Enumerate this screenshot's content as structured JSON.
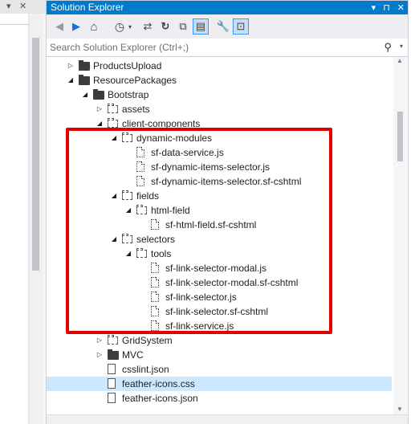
{
  "left_panel": {
    "top_glyphs": [
      "▾",
      "✕"
    ],
    "split_glyph": "✣"
  },
  "panel": {
    "title": "Solution Explorer",
    "title_buttons": {
      "dropdown": "▾",
      "pin": "⊓",
      "close": "✕"
    }
  },
  "toolbar": {
    "back": "◀",
    "forward": "▶",
    "home": "⌂",
    "history": "◷",
    "history_drop": "▾",
    "sync": "⇄",
    "refresh": "↻",
    "collapse": "⧉",
    "show_all": "▤",
    "properties": "🔧",
    "preview": "⊡"
  },
  "search": {
    "placeholder": "Search Solution Explorer (Ctrl+;)",
    "icon": "⚲",
    "dropdown": "▾"
  },
  "tree": [
    {
      "label": "ProductsUpload",
      "icon": "folder-dark",
      "expander": "expand",
      "depth": 0
    },
    {
      "label": "ResourcePackages",
      "icon": "folder-dark",
      "expander": "collapse",
      "depth": 0
    },
    {
      "label": "Bootstrap",
      "icon": "folder-dark",
      "expander": "collapse",
      "depth": 1
    },
    {
      "label": "assets",
      "icon": "folder-dash",
      "expander": "expand",
      "depth": 2
    },
    {
      "label": "client-components",
      "icon": "folder-dash",
      "expander": "collapse",
      "depth": 2
    },
    {
      "label": "dynamic-modules",
      "icon": "folder-dash",
      "expander": "collapse",
      "depth": 3
    },
    {
      "label": "sf-data-service.js",
      "icon": "file",
      "expander": "",
      "depth": 4
    },
    {
      "label": "sf-dynamic-items-selector.js",
      "icon": "file",
      "expander": "",
      "depth": 4
    },
    {
      "label": "sf-dynamic-items-selector.sf-cshtml",
      "icon": "file",
      "expander": "",
      "depth": 4
    },
    {
      "label": "fields",
      "icon": "folder-dash",
      "expander": "collapse",
      "depth": 3
    },
    {
      "label": "html-field",
      "icon": "folder-dash",
      "expander": "collapse",
      "depth": 4
    },
    {
      "label": "sf-html-field.sf-cshtml",
      "icon": "file",
      "expander": "",
      "depth": 5
    },
    {
      "label": "selectors",
      "icon": "folder-dash",
      "expander": "collapse",
      "depth": 3
    },
    {
      "label": "tools",
      "icon": "folder-dash",
      "expander": "collapse",
      "depth": 4
    },
    {
      "label": "sf-link-selector-modal.js",
      "icon": "file",
      "expander": "",
      "depth": 5
    },
    {
      "label": "sf-link-selector-modal.sf-cshtml",
      "icon": "file",
      "expander": "",
      "depth": 5
    },
    {
      "label": "sf-link-selector.js",
      "icon": "file",
      "expander": "",
      "depth": 5
    },
    {
      "label": "sf-link-selector.sf-cshtml",
      "icon": "file",
      "expander": "",
      "depth": 5
    },
    {
      "label": "sf-link-service.js",
      "icon": "file",
      "expander": "",
      "depth": 5
    },
    {
      "label": "GridSystem",
      "icon": "folder-dash",
      "expander": "expand",
      "depth": 2
    },
    {
      "label": "MVC",
      "icon": "folder-dark",
      "expander": "expand",
      "depth": 2
    },
    {
      "label": "csslint.json",
      "icon": "file-solid",
      "expander": "",
      "depth": 2
    },
    {
      "label": "feather-icons.css",
      "icon": "file-solid",
      "expander": "",
      "depth": 2,
      "selected": true
    },
    {
      "label": "feather-icons.json",
      "icon": "file-solid",
      "expander": "",
      "depth": 2
    }
  ],
  "scrollbar": {
    "up": "▲",
    "down": "▼"
  },
  "colors": {
    "title_bar": "#007acc",
    "selection": "#cce8ff",
    "callout_border": "#e00000"
  }
}
